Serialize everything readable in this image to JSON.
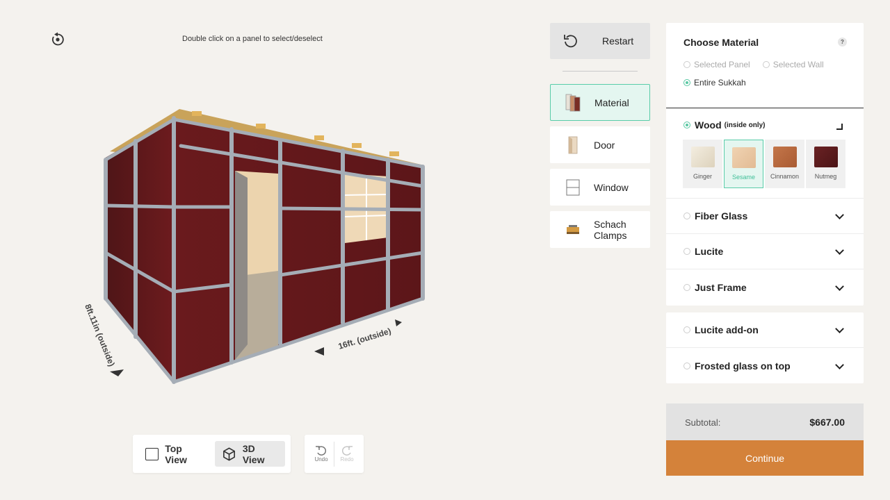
{
  "hint": "Double click on a panel to select/deselect",
  "dimensions": {
    "width_label": "8ft.11in (outside)",
    "length_label": "16ft. (outside)"
  },
  "view": {
    "top_label": "Top View",
    "threed_label": "3D View",
    "active": "3D View"
  },
  "history": {
    "undo_label": "Undo",
    "redo_label": "Redo"
  },
  "tools": {
    "restart_label": "Restart",
    "items": [
      {
        "label": "Material",
        "icon": "panels-icon",
        "active": true
      },
      {
        "label": "Door",
        "icon": "door-icon",
        "active": false
      },
      {
        "label": "Window",
        "icon": "window-icon",
        "active": false
      },
      {
        "label": "Schach Clamps",
        "icon": "clamp-icon",
        "active": false
      }
    ]
  },
  "material": {
    "title": "Choose Material",
    "help": "?",
    "scope_options": [
      "Selected Panel",
      "Selected Wall",
      "Entire Sukkah"
    ],
    "scope_selected": "Entire Sukkah",
    "wood_label": "Wood",
    "wood_sub": "(inside only)",
    "swatches": [
      {
        "label": "Ginger",
        "color": "#ece4d2"
      },
      {
        "label": "Sesame",
        "color": "#ebc9a6",
        "active": true
      },
      {
        "label": "Cinnamon",
        "color": "#b8683e"
      },
      {
        "label": "Nutmeg",
        "color": "#5a1a1c"
      }
    ],
    "options": [
      "Fiber Glass",
      "Lucite",
      "Just Frame"
    ],
    "addons": [
      "Lucite add-on",
      "Frosted glass on top"
    ]
  },
  "colors": {
    "accent": "#58c7a2",
    "continue": "#d4823a",
    "wall": "#6a1a1d",
    "frame": "#9aa3ad"
  },
  "subtotal": {
    "label": "Subtotal:",
    "amount": "$667.00"
  },
  "continue_label": "Continue"
}
